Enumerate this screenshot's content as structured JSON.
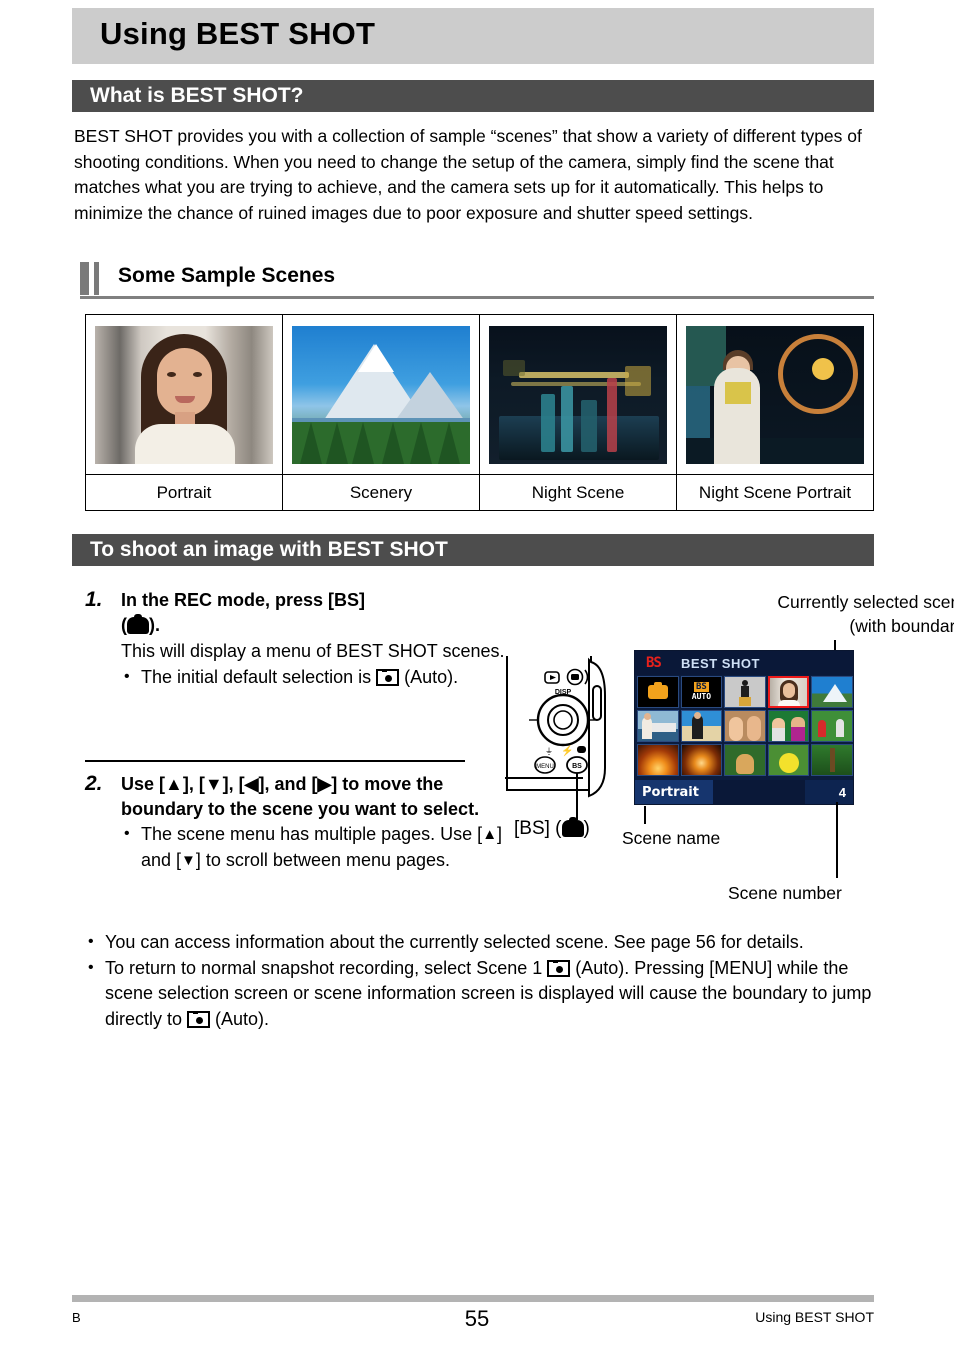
{
  "page": {
    "title": "Using BEST SHOT",
    "footer": {
      "left": "B",
      "page_number": "55",
      "right": "Using BEST SHOT"
    }
  },
  "section_what": {
    "heading": "What is BEST SHOT?",
    "paragraph": "BEST SHOT provides you with a collection of sample “scenes” that show a variety of different types of shooting conditions. When you need to change the setup of the camera, simply find the scene that matches what you are trying to achieve, and the camera sets up for it automatically. This helps to minimize the chance of ruined images due to poor exposure and shutter speed settings."
  },
  "sample_scenes": {
    "heading": "Some Sample Scenes",
    "items": [
      {
        "caption": "Portrait"
      },
      {
        "caption": "Scenery"
      },
      {
        "caption": "Night Scene"
      },
      {
        "caption": "Night Scene Portrait"
      }
    ]
  },
  "section_shoot": {
    "heading": "To shoot an image with BEST SHOT",
    "steps": [
      {
        "number": "1.",
        "title_a": "In the REC mode, press [BS]",
        "title_b": "(",
        "title_c": ").",
        "desc": "This will display a menu of BEST SHOT scenes.",
        "bullets_a": "The initial default selection is ",
        "bullets_b": " (Auto)."
      },
      {
        "number": "2.",
        "title": "Use [▲], [▼], [◀], and [▶] to move the boundary to the scene you want to select.",
        "bullet1_a": "The scene menu has multiple pages. Use [",
        "bullet1_b": "] and [",
        "bullet1_c": "] to scroll between menu pages.",
        "bullet2": "You can access information about the currently selected scene. See page 56 for details.",
        "bullet3_a": "To return to normal snapshot recording, select Scene 1 ",
        "bullet3_b": " (Auto). Pressing [MENU] while the scene selection screen or scene information screen is displayed will cause the boundary to jump directly to ",
        "bullet3_c": " (Auto)."
      }
    ]
  },
  "illustration": {
    "callout_top_line1": "Currently selected scene",
    "callout_top_line2": "(with boundary)",
    "caption_scene_name": "Scene name",
    "caption_scene_number": "Scene number",
    "bs_button_label_a": "[BS] (",
    "bs_button_label_b": ")",
    "lcd": {
      "bs_badge": "BS",
      "title": "BEST SHOT",
      "bs_auto_top": "BS",
      "bs_auto_bottom": "AUTO",
      "scene_name": "Portrait",
      "scene_number": "4"
    }
  },
  "colors": {
    "title_bar_bg": "#cccccc",
    "section_bar_bg": "#4d4d4d",
    "marker_gray": "#7a7a7a",
    "lcd_bg": "#0b1c3e",
    "lcd_header_bg": "#0a1838",
    "selection_red": "#ef1a1a",
    "bs_red": "#e8211c",
    "accent_orange": "#f2a21c",
    "footer_rule": "#b3b3b3"
  }
}
